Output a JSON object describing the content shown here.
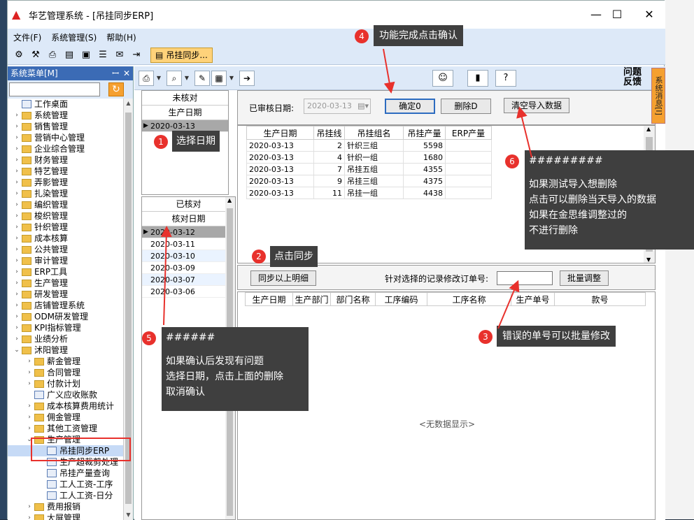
{
  "window": {
    "title": "华艺管理系统 - [吊挂同步ERP]",
    "min": "—",
    "max": "☐",
    "close": "✕"
  },
  "menu": [
    {
      "label": "文件(F)"
    },
    {
      "label": "系统管理(S)"
    },
    {
      "label": "帮助(H)"
    }
  ],
  "toolbar": {
    "tab_label": "吊挂同步..."
  },
  "left": {
    "header": "系统菜单[M]",
    "pin": "ꟷ",
    "close": "✕",
    "tree": [
      {
        "label": "工作桌面",
        "type": "doc",
        "indent": 0,
        "exp": ""
      },
      {
        "label": "系统管理",
        "type": "folder",
        "indent": 0,
        "exp": "›"
      },
      {
        "label": "销售管理",
        "type": "folder",
        "indent": 0,
        "exp": "›"
      },
      {
        "label": "营销中心管理",
        "type": "folder",
        "indent": 0,
        "exp": "›"
      },
      {
        "label": "企业综合管理",
        "type": "folder",
        "indent": 0,
        "exp": "›"
      },
      {
        "label": "财务管理",
        "type": "folder",
        "indent": 0,
        "exp": "›"
      },
      {
        "label": "特艺管理",
        "type": "folder",
        "indent": 0,
        "exp": "›"
      },
      {
        "label": "弄影管理",
        "type": "folder",
        "indent": 0,
        "exp": "›"
      },
      {
        "label": "扎染管理",
        "type": "folder",
        "indent": 0,
        "exp": "›"
      },
      {
        "label": "编织管理",
        "type": "folder",
        "indent": 0,
        "exp": "›"
      },
      {
        "label": "梭织管理",
        "type": "folder",
        "indent": 0,
        "exp": "›"
      },
      {
        "label": "针织管理",
        "type": "folder",
        "indent": 0,
        "exp": "›"
      },
      {
        "label": "成本核算",
        "type": "folder",
        "indent": 0,
        "exp": "›"
      },
      {
        "label": "公共管理",
        "type": "folder",
        "indent": 0,
        "exp": "›"
      },
      {
        "label": "审计管理",
        "type": "folder",
        "indent": 0,
        "exp": "›"
      },
      {
        "label": "ERP工具",
        "type": "folder",
        "indent": 0,
        "exp": "›"
      },
      {
        "label": "生产管理",
        "type": "folder",
        "indent": 0,
        "exp": "›"
      },
      {
        "label": "研发管理",
        "type": "folder",
        "indent": 0,
        "exp": "›"
      },
      {
        "label": "店铺管理系统",
        "type": "folder",
        "indent": 0,
        "exp": "›"
      },
      {
        "label": "ODM研发管理",
        "type": "folder",
        "indent": 0,
        "exp": "›"
      },
      {
        "label": "KPI指标管理",
        "type": "folder",
        "indent": 0,
        "exp": "›"
      },
      {
        "label": "业绩分析",
        "type": "folder",
        "indent": 0,
        "exp": "›"
      },
      {
        "label": "沭阳管理",
        "type": "folder",
        "indent": 0,
        "exp": "⌄"
      },
      {
        "label": "薪金管理",
        "type": "folder",
        "indent": 1,
        "exp": "›"
      },
      {
        "label": "合同管理",
        "type": "folder",
        "indent": 1,
        "exp": "›"
      },
      {
        "label": "付款计划",
        "type": "folder",
        "indent": 1,
        "exp": "›"
      },
      {
        "label": "广义应收账款",
        "type": "doc",
        "indent": 1,
        "exp": ""
      },
      {
        "label": "成本核算费用统计",
        "type": "folder",
        "indent": 1,
        "exp": "›"
      },
      {
        "label": "佣金管理",
        "type": "folder",
        "indent": 1,
        "exp": "›"
      },
      {
        "label": "其他工资管理",
        "type": "folder",
        "indent": 1,
        "exp": "›"
      },
      {
        "label": "生产管理",
        "type": "folder",
        "indent": 1,
        "exp": "⌄"
      },
      {
        "label": "吊挂同步ERP",
        "type": "doc",
        "indent": 2,
        "exp": "",
        "sel": true
      },
      {
        "label": "生产超裁剪处理",
        "type": "doc",
        "indent": 2,
        "exp": ""
      },
      {
        "label": "吊挂产量查询",
        "type": "doc",
        "indent": 2,
        "exp": ""
      },
      {
        "label": "工人工资-工序",
        "type": "doc",
        "indent": 2,
        "exp": ""
      },
      {
        "label": "工人工资-日分",
        "type": "doc",
        "indent": 2,
        "exp": ""
      },
      {
        "label": "费用报销",
        "type": "folder",
        "indent": 1,
        "exp": "›"
      },
      {
        "label": "大屏管理",
        "type": "folder",
        "indent": 1,
        "exp": "›"
      }
    ]
  },
  "main": {
    "wenti": "问题反馈",
    "sidetab": "系统消息[I]",
    "unchecked": {
      "h1": "未核对",
      "h2": "生产日期",
      "rows": [
        {
          "d": "2020-03-13",
          "sel": true
        }
      ]
    },
    "checked": {
      "h1": "已核对",
      "h2": "核对日期",
      "rows": [
        {
          "d": "2020-03-12",
          "sel": true
        },
        {
          "d": "2020-03-11"
        },
        {
          "d": "2020-03-10"
        },
        {
          "d": "2020-03-09"
        },
        {
          "d": "2020-03-07"
        },
        {
          "d": "2020-03-06"
        }
      ]
    },
    "review": {
      "label": "已审核日期:",
      "date": "2020-03-13",
      "confirm": "确定0",
      "delete": "删除D",
      "clear": "清空导入数据"
    },
    "top_table": {
      "headers": [
        "生产日期",
        "吊挂线",
        "吊挂组名",
        "吊挂产量",
        "ERP产量"
      ],
      "rows": [
        [
          "2020-03-13",
          "2",
          "针织三组",
          "5598",
          ""
        ],
        [
          "2020-03-13",
          "4",
          "针织一组",
          "1680",
          ""
        ],
        [
          "2020-03-13",
          "7",
          "吊挂五组",
          "4355",
          ""
        ],
        [
          "2020-03-13",
          "9",
          "吊挂三组",
          "4375",
          ""
        ],
        [
          "2020-03-13",
          "11",
          "吊挂一组",
          "4438",
          ""
        ]
      ]
    },
    "sync": {
      "btn": "同步以上明细",
      "label": "针对选择的记录修改订单号:",
      "input": "",
      "batch": "批量调整"
    },
    "bottom_table": {
      "headers": [
        "生产日期",
        "生产部门",
        "部门名称",
        "工序编码",
        "工序名称",
        "生产单号",
        "款号"
      ],
      "empty": "<无数据显示>"
    }
  },
  "notes": [
    {
      "num": "1",
      "text": "选择日期"
    },
    {
      "num": "2",
      "text": "点击同步"
    },
    {
      "num": "3",
      "text": "错误的单号可以批量修改"
    },
    {
      "num": "4",
      "text": "功能完成点击确认"
    },
    {
      "num": "5",
      "title": "######",
      "lines": [
        "如果确认后发现有问题",
        "选择日期，点击上面的删除",
        "取消确认"
      ]
    },
    {
      "num": "6",
      "title": "#########",
      "lines": [
        "如果测试导入想删除",
        "点击可以删除当天导入的数据",
        "如果在金思维调整过的",
        "不进行删除"
      ]
    }
  ],
  "colors": {
    "accent": "#2d6cc0",
    "annotation_red": "#e8312c",
    "note_bg": "#3f3f3f",
    "menu_bg": "#dde9f8"
  }
}
